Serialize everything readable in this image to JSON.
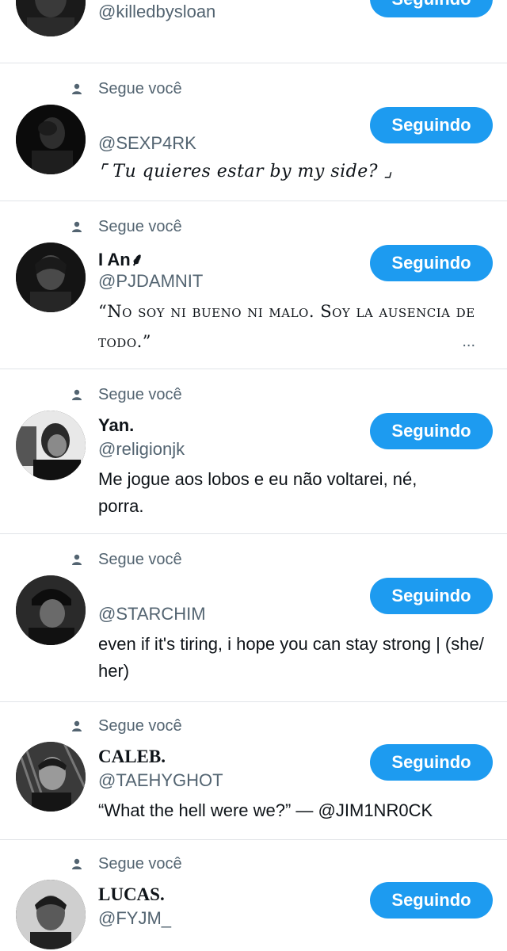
{
  "colors": {
    "accent": "#1d9bf0",
    "secondary_text": "#536471",
    "divider": "#e1e4e8"
  },
  "items": [
    {
      "name": "",
      "handle": "@killedbysloan",
      "button": "Seguindo",
      "follows_you": "",
      "bio": ""
    },
    {
      "follows_you": "Segue você",
      "name": "",
      "handle": "@SEXP4RK",
      "bio": "⌜ Tu quieres estar by my side? ⌟",
      "button": "Seguindo"
    },
    {
      "follows_you": "Segue você",
      "name": "I An⸙",
      "handle": "@PJDAMNIT",
      "bio": "“No soy ni bueno ni malo. Soy la ausencia de todo.”",
      "bio_more": "...",
      "button": "Seguindo"
    },
    {
      "follows_you": "Segue você",
      "name": "Yan.",
      "handle": "@religionjk",
      "bio": "Me jogue aos lobos e eu não voltarei, né, porra.",
      "button": "Seguindo"
    },
    {
      "follows_you": "Segue você",
      "name": "",
      "handle": "@STARCHIM",
      "bio": "  even if it's tiring, i hope you can stay strong | (she/ her)",
      "button": "Seguindo"
    },
    {
      "follows_you": "Segue você",
      "name": "CALEB.",
      "handle": "@TAEHYGHOT",
      "bio": "“What the hell were we?” — @JIM1NR0CK",
      "button": "Seguindo"
    },
    {
      "follows_you": "Segue você",
      "name": "LUCAS.",
      "handle": "@FYJM_",
      "bio": "",
      "button": "Seguindo"
    }
  ]
}
